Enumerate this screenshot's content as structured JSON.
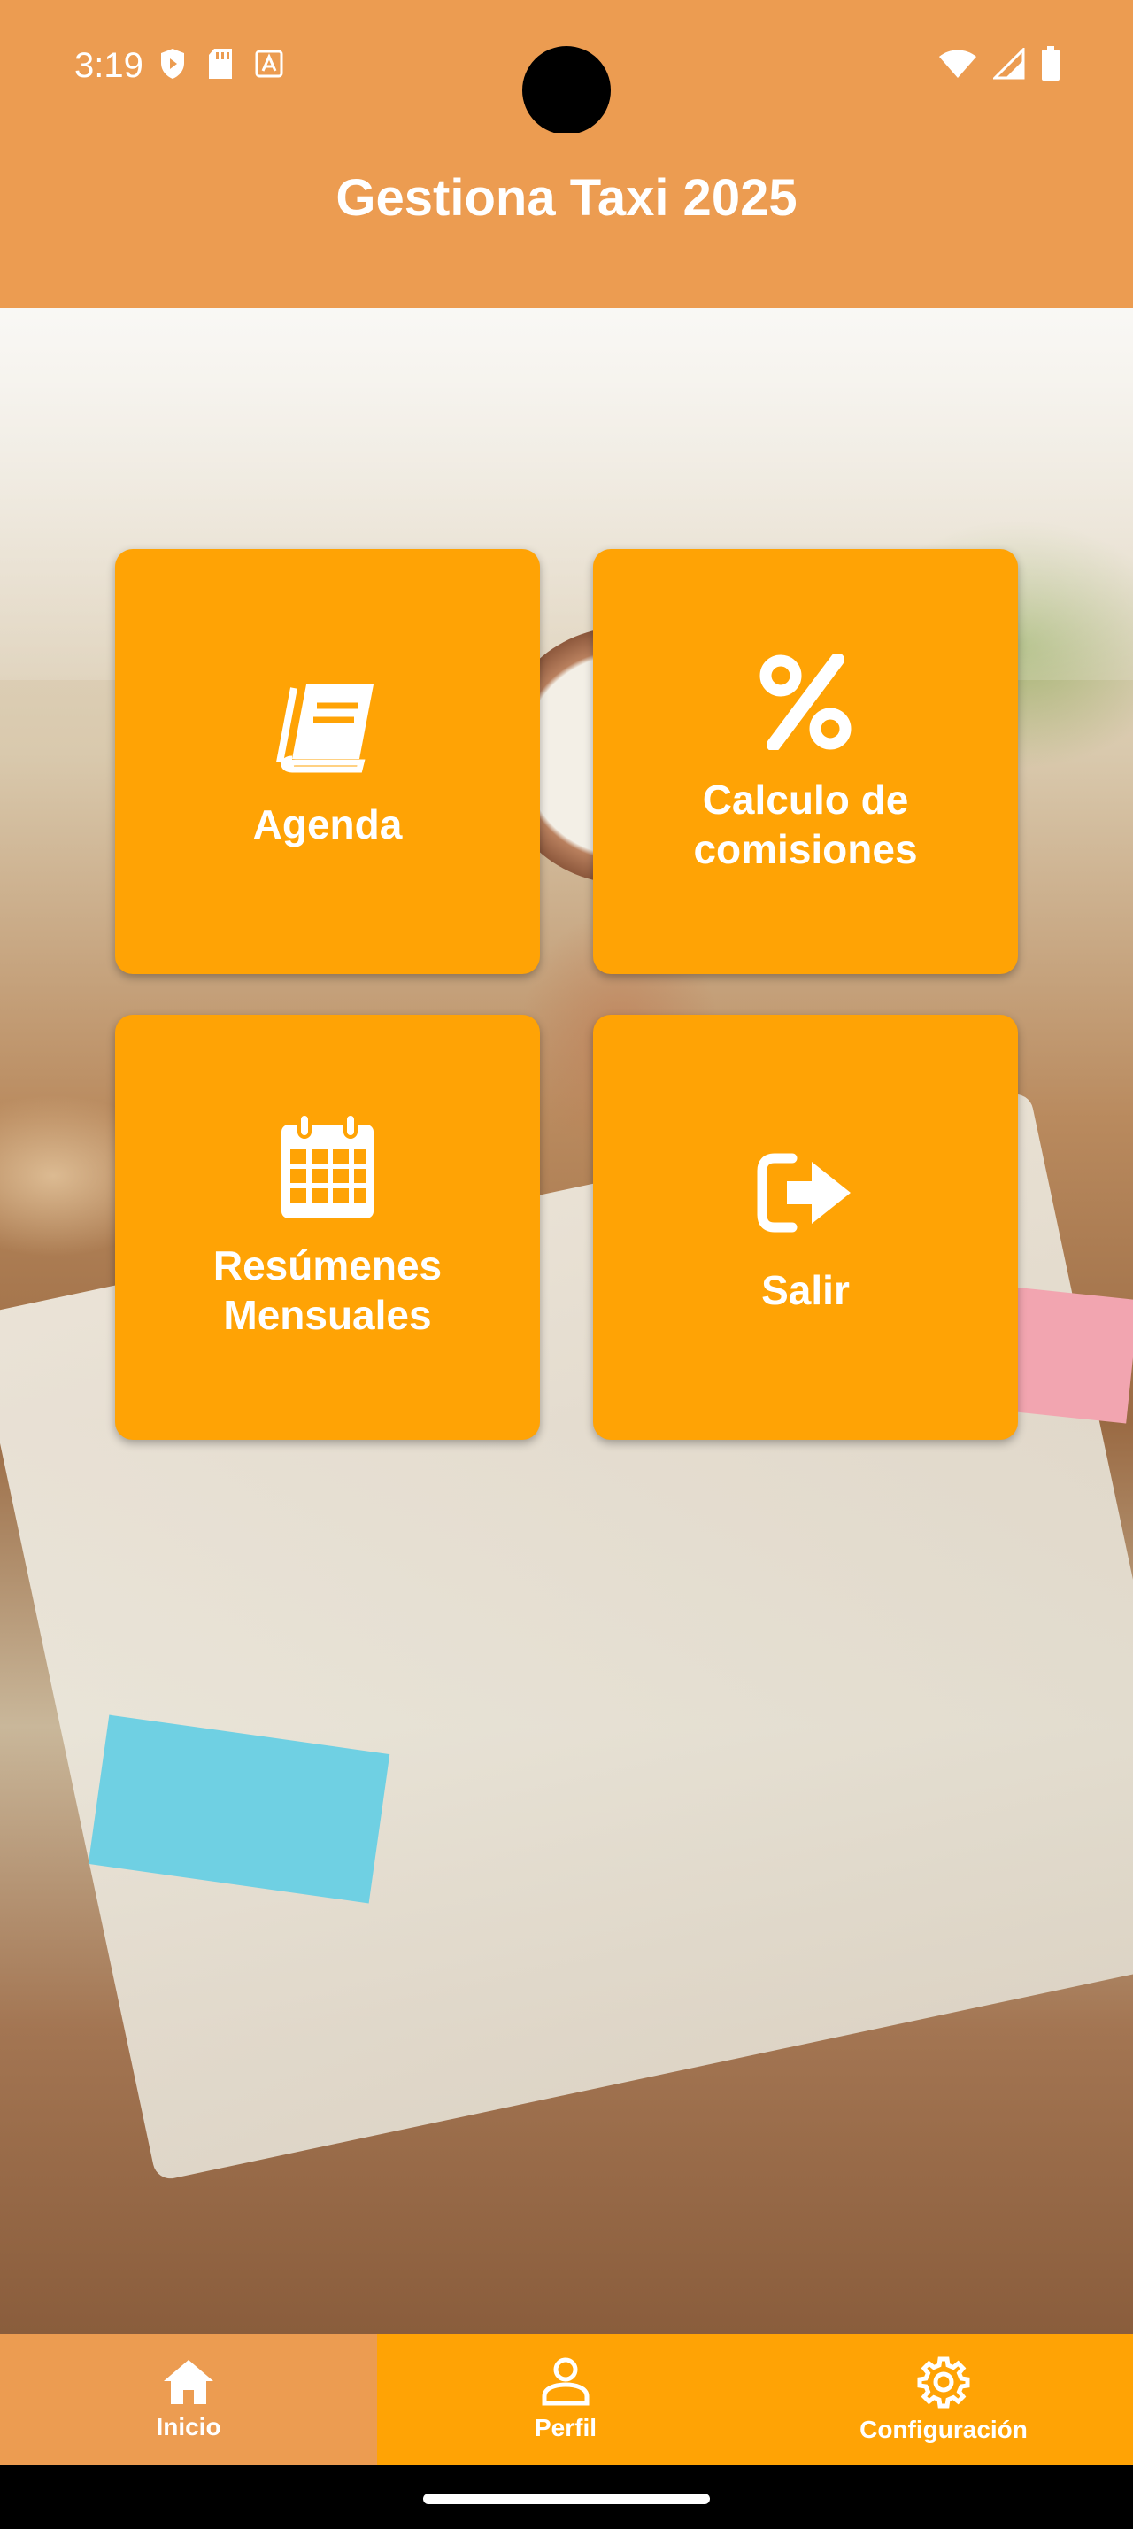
{
  "status_bar": {
    "time": "3:19",
    "left_icons": [
      "shield-icon",
      "sd-card-icon",
      "font-icon"
    ],
    "right_icons": [
      "wifi-icon",
      "signal-icon",
      "battery-icon"
    ]
  },
  "header": {
    "title": "Gestiona Taxi 2025"
  },
  "tiles": [
    {
      "label": "Agenda",
      "icon": "book-icon"
    },
    {
      "label": "Calculo de\ncomisiones",
      "icon": "percent-icon"
    },
    {
      "label": "Resúmenes\nMensuales",
      "icon": "calendar-icon"
    },
    {
      "label": "Salir",
      "icon": "sign-out-icon"
    }
  ],
  "bottom_nav": [
    {
      "label": "Inicio",
      "icon": "home-icon",
      "active": true
    },
    {
      "label": "Perfil",
      "icon": "person-icon",
      "active": false
    },
    {
      "label": "Configuración",
      "icon": "gear-icon",
      "active": false
    }
  ],
  "colors": {
    "header_bg": "#EC9C51",
    "tile_bg": "#FFA305",
    "nav_bg": "#FFA305",
    "nav_active_bg": "#EC9C51",
    "text": "#FFFFFF"
  }
}
